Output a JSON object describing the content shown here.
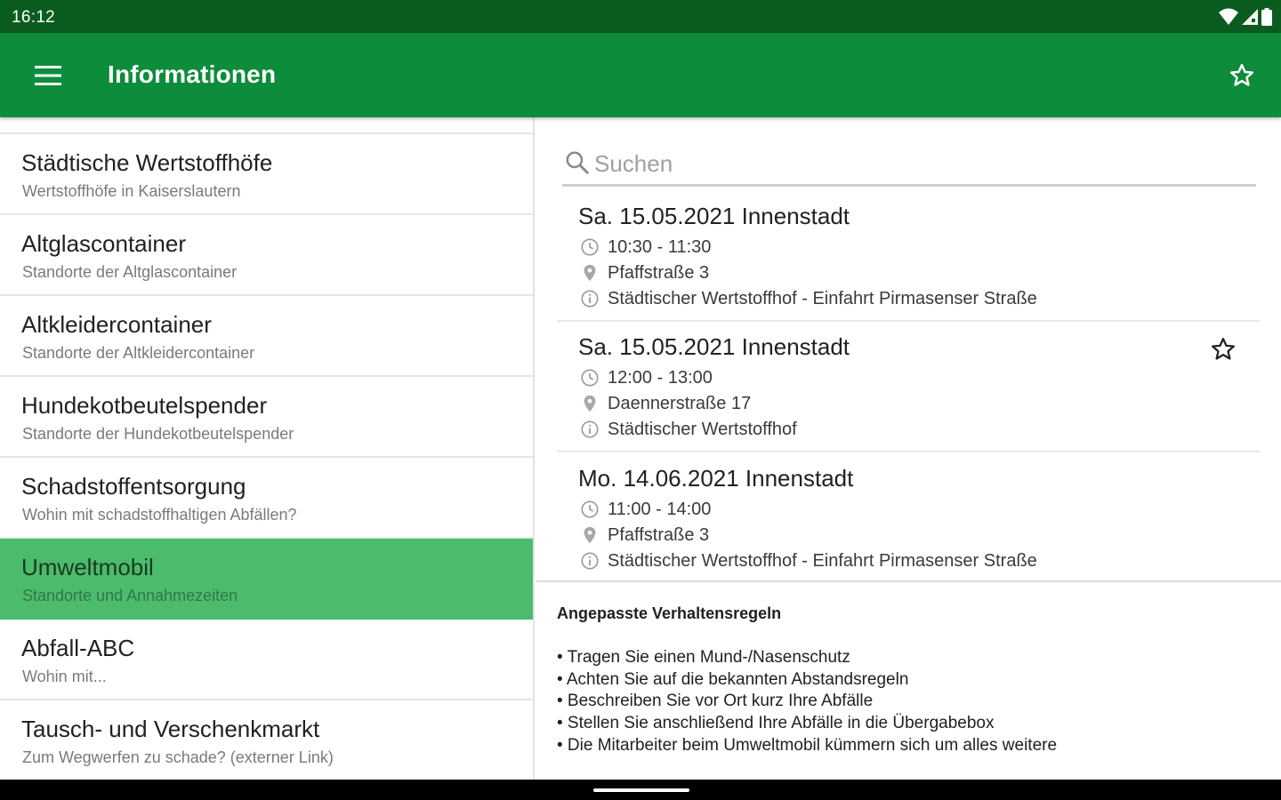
{
  "status_bar": {
    "time": "16:12"
  },
  "app_bar": {
    "title": "Informationen"
  },
  "nav_list": [
    {
      "title": "Städtische Wertstoffhöfe",
      "subtitle": "Wertstoffhöfe in Kaiserslautern"
    },
    {
      "title": "Altglascontainer",
      "subtitle": "Standorte der Altglascontainer"
    },
    {
      "title": "Altkleidercontainer",
      "subtitle": "Standorte der Altkleidercontainer"
    },
    {
      "title": "Hundekotbeutelspender",
      "subtitle": "Standorte der Hundekotbeutelspender"
    },
    {
      "title": "Schadstoffentsorgung",
      "subtitle": "Wohin mit schadstoffhaltigen Abfällen?"
    },
    {
      "title": "Umweltmobil",
      "subtitle": "Standorte und Annahmezeiten",
      "selected": true
    },
    {
      "title": "Abfall-ABC",
      "subtitle": "Wohin mit..."
    },
    {
      "title": "Tausch- und Verschenkmarkt",
      "subtitle": "Zum Wegwerfen zu schade? (externer Link)"
    }
  ],
  "search": {
    "placeholder": "Suchen",
    "value": ""
  },
  "events": [
    {
      "title": "Sa. 15.05.2021 Innenstadt",
      "time": "10:30 - 11:30",
      "location": "Pfaffstraße 3",
      "info": "Städtischer Wertstoffhof - Einfahrt Pirmasenser Straße",
      "starred": false
    },
    {
      "title": "Sa. 15.05.2021 Innenstadt",
      "time": "12:00 - 13:00",
      "location": "Daennerstraße 17",
      "info": "Städtischer Wertstoffhof",
      "starred": true
    },
    {
      "title": "Mo. 14.06.2021 Innenstadt",
      "time": "11:00 - 14:00",
      "location": "Pfaffstraße 3",
      "info": "Städtischer Wertstoffhof - Einfahrt Pirmasenser Straße",
      "starred": false
    }
  ],
  "rules": {
    "title": "Angepasste Verhaltensregeln",
    "items": [
      "• Tragen Sie einen Mund-/Nasenschutz",
      "• Achten Sie auf die bekannten Abstandsregeln",
      "• Beschreiben Sie vor Ort kurz Ihre Abfälle",
      "• Stellen Sie anschließend Ihre Abfälle in die Übergabebox",
      "• Die Mitarbeiter beim Umweltmobil kümmern sich um alles weitere"
    ]
  },
  "colors": {
    "status_bar": "#0a5c1e",
    "app_bar": "#0d8c3b",
    "selected_item": "#4cbb6c"
  },
  "icons": {
    "menu": "menu-icon",
    "favorite": "star-outline-icon",
    "search": "search-icon",
    "time": "clock-icon",
    "location": "location-pin-icon",
    "info": "info-icon"
  }
}
